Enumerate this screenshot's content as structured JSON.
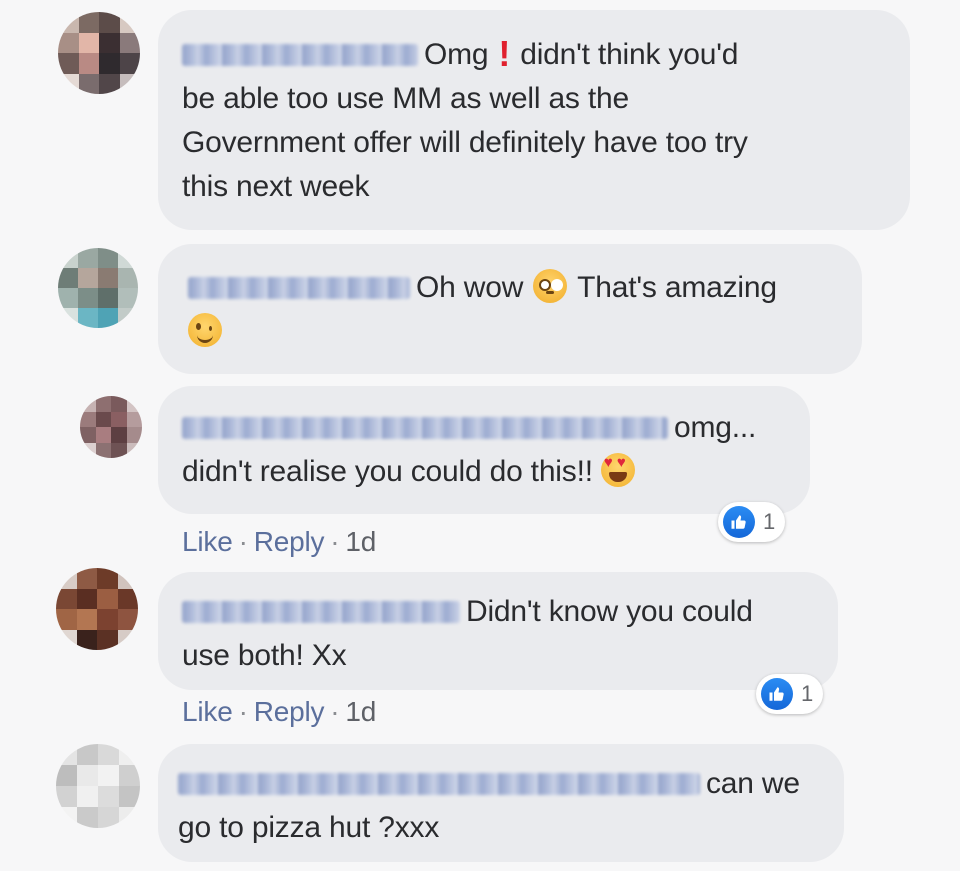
{
  "comments": [
    {
      "text_parts": [
        "Omg",
        "didn't think you'd",
        "be able too use MM as well as the",
        "Government offer will definitely have too try",
        "this next week"
      ]
    },
    {
      "text_parts": [
        "Oh wow",
        "That's amazing"
      ]
    },
    {
      "text_parts": [
        "omg...",
        "didn't realise you could do this!!"
      ],
      "actions": {
        "like": "Like",
        "reply": "Reply",
        "time": "1d"
      },
      "reaction_count": "1"
    },
    {
      "text_parts": [
        "Didn't know you could",
        "use both! Xx"
      ],
      "actions": {
        "like": "Like",
        "reply": "Reply",
        "time": "1d"
      },
      "reaction_count": "1"
    },
    {
      "text_parts": [
        "can we",
        "go to pizza hut ?xxx"
      ]
    }
  ],
  "icons": {
    "exclaim": "heavy-exclamation-mark",
    "flushed": "flushed-face-emoji",
    "wink": "winking-face-emoji",
    "heart_eyes": "heart-eyes-emoji",
    "like": "thumbs-up-icon"
  },
  "colors": {
    "bubble": "#eaebee",
    "link": "#5b6f9c",
    "like_blue": "#1877f2",
    "exclaim_red": "#e0202e"
  }
}
